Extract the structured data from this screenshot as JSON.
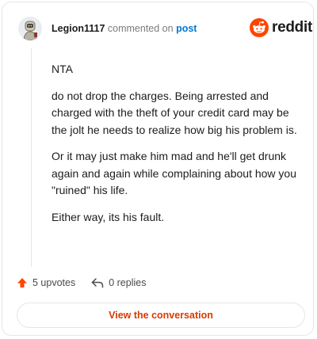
{
  "comment": {
    "username": "Legion1117",
    "commented_on": "commented on",
    "post_link": "post",
    "paragraphs": [
      "NTA",
      "do not drop the charges. Being arrested and charged with the theft of your credit card may be the jolt he needs to realize how big his problem is.",
      "Or it may just make him mad and he'll get drunk again and again while complaining about how you \"ruined\" his life.",
      "Either way, its his fault."
    ]
  },
  "brand": {
    "name": "reddit",
    "icon": "reddit-snoo-icon",
    "accent": "#ff4500"
  },
  "actions": {
    "upvotes_label": "5 upvotes",
    "replies_label": "0 replies",
    "upvote_icon": "upvote-arrow-icon",
    "reply_icon": "reply-arrow-icon"
  },
  "cta": {
    "label": "View the conversation",
    "color": "#d93a00"
  }
}
